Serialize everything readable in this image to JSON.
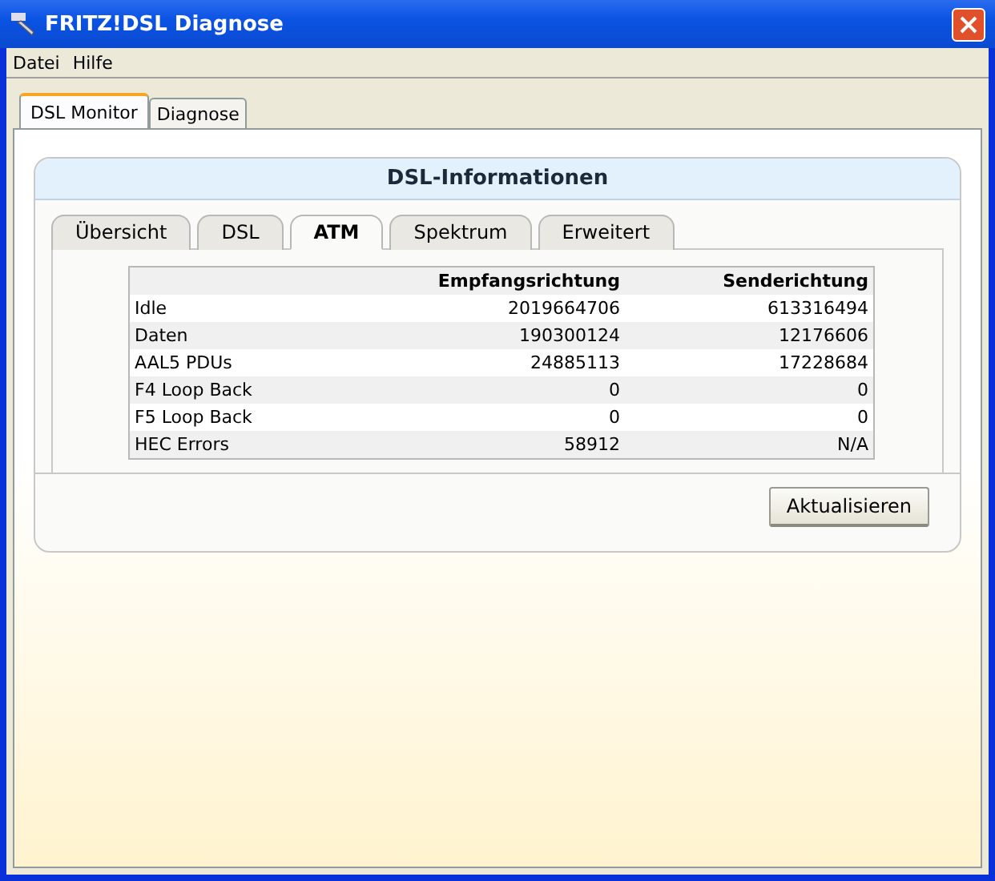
{
  "window": {
    "title": "FRITZ!DSL Diagnose"
  },
  "menu": [
    "Datei",
    "Hilfe"
  ],
  "tabs": [
    {
      "label": "DSL Monitor",
      "selected": true
    },
    {
      "label": "Diagnose",
      "selected": false
    }
  ],
  "card": {
    "title": "DSL-Informationen",
    "tabs": [
      {
        "label": "Übersicht",
        "selected": false
      },
      {
        "label": "DSL",
        "selected": false
      },
      {
        "label": "ATM",
        "selected": true
      },
      {
        "label": "Spektrum",
        "selected": false
      },
      {
        "label": "Erweitert",
        "selected": false
      }
    ],
    "table": {
      "columns": [
        "",
        "Empfangsrichtung",
        "Senderichtung"
      ],
      "rows": [
        [
          "Idle",
          "2019664706",
          "613316494"
        ],
        [
          "Daten",
          "190300124",
          "12176606"
        ],
        [
          "AAL5 PDUs",
          "24885113",
          "17228684"
        ],
        [
          "F4 Loop Back",
          "0",
          "0"
        ],
        [
          "F5 Loop Back",
          "0",
          "0"
        ],
        [
          "HEC Errors",
          "58912",
          "N/A"
        ]
      ]
    },
    "button": "Aktualisieren"
  }
}
